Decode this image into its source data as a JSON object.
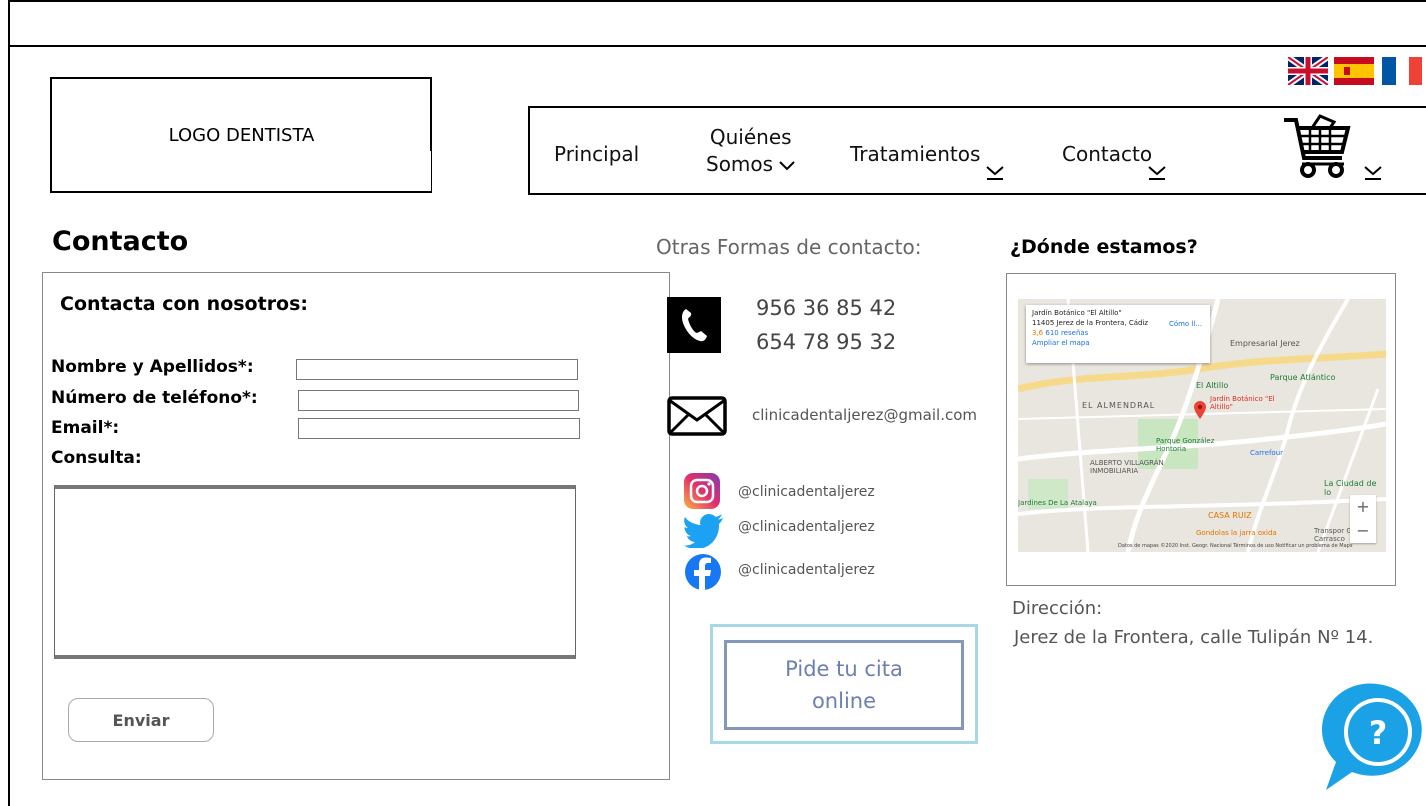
{
  "header": {
    "logo_text": "LOGO DENTISTA"
  },
  "languages": [
    "english-flag",
    "spanish-flag",
    "french-flag"
  ],
  "nav": {
    "principal": "Principal",
    "quienes_line1": "Quiénes",
    "quienes_line2": "Somos",
    "tratamientos": "Tratamientos",
    "contacto": "Contacto"
  },
  "page": {
    "title": "Contacto"
  },
  "form": {
    "heading": "Contacta con nosotros:",
    "name_label": "Nombre y Apellidos*:",
    "phone_label": "Número de teléfono*:",
    "email_label": "Email*:",
    "query_label": "Consulta:",
    "name_value": "",
    "phone_value": "",
    "email_value": "",
    "submit_label": "Enviar"
  },
  "contact": {
    "heading": "Otras Formas de contacto:",
    "phones": [
      "956 36 85 42",
      "654 78 95 32"
    ],
    "email": "clinicadentaljerez@gmail.com",
    "instagram": "@clinicadentaljerez",
    "twitter": "@clinicadentaljerez",
    "facebook": "@clinicadentaljerez",
    "cita_line1": "Pide tu cita",
    "cita_line2": "online"
  },
  "location": {
    "heading": "¿Dónde estamos?",
    "address_label": "Dirección:",
    "address": "Jerez de la Frontera, calle Tulipán Nº 14."
  },
  "map": {
    "card_title": "Jardín Botánico \"El Altillo\"",
    "card_address": "11405 Jerez de la Frontera, Cádiz",
    "card_rating": "3,6",
    "card_reviews": "610 reseñas",
    "card_link": "Ampliar el mapa",
    "card_directions": "Cómo ll...",
    "labels": [
      "Empresarial Jerez",
      "El Altillo",
      "Parque Atlántico",
      "EL ALMENDRAL",
      "Jardín Botánico \"El Altillo\"",
      "Parque González Hontoria",
      "ALBERTO VILLAGRÁN INMOBILIARIA",
      "La Ciudad de lo",
      "Jardines De La Atalaya",
      "CASA RUIZ",
      "Gondolas la jarra oxida",
      "Transpor Grúas Carrasco",
      "Carrefour"
    ],
    "footer": "Datos de mapas ©2020 Inst. Geogr. Nacional  Términos de uso  Notificar un problema de Maps"
  },
  "colors": {
    "cita_border_outer": "#a8d8e6",
    "cita_border_inner": "#8597b8",
    "cita_text": "#6b7fb0",
    "help_bubble": "#1ba1e6",
    "twitter": "#1da1f2",
    "facebook": "#1877f2"
  }
}
